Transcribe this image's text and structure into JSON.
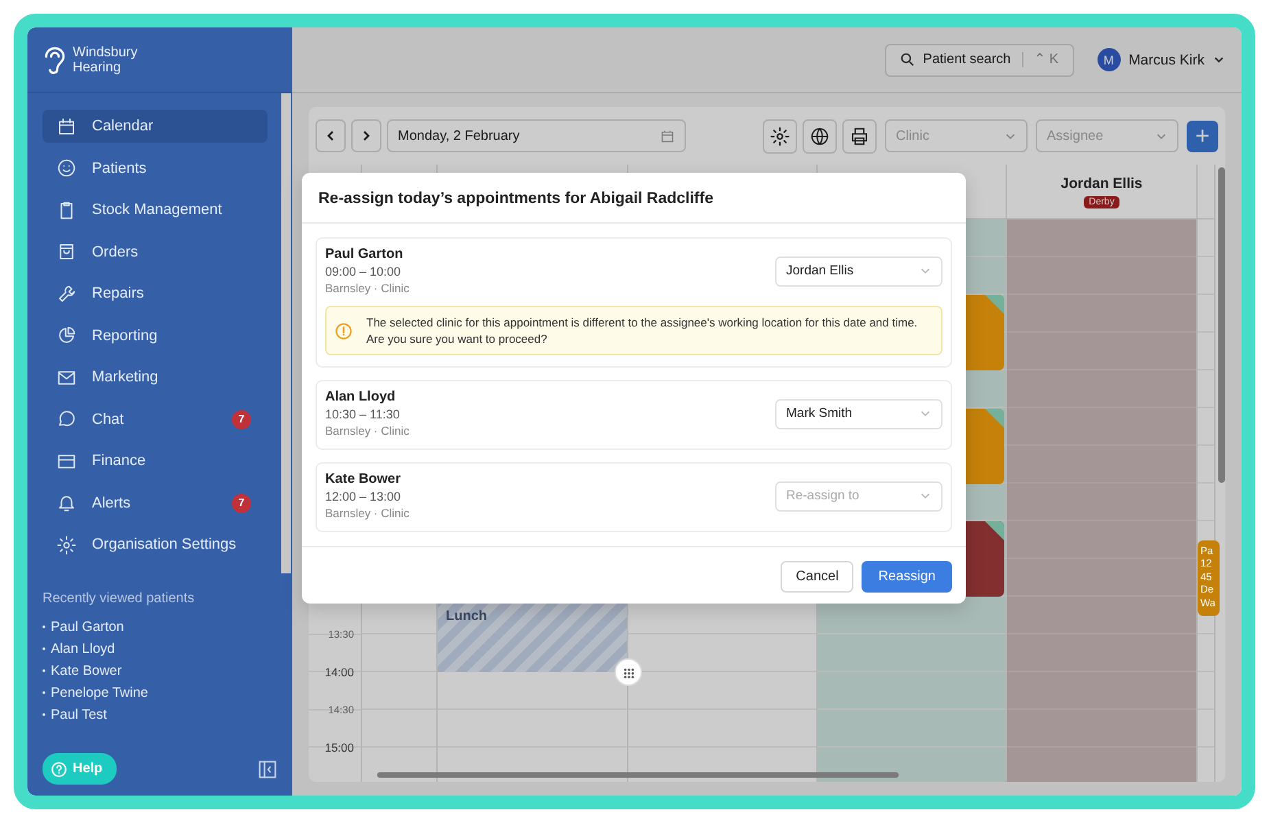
{
  "brand": {
    "line1": "Windsbury",
    "line2": "Hearing"
  },
  "nav": [
    {
      "label": "Calendar",
      "selected": true
    },
    {
      "label": "Patients",
      "selected": false
    },
    {
      "label": "Stock Management",
      "selected": false
    },
    {
      "label": "Orders",
      "selected": false
    },
    {
      "label": "Repairs",
      "selected": false
    },
    {
      "label": "Reporting",
      "selected": false
    },
    {
      "label": "Marketing",
      "selected": false
    },
    {
      "label": "Chat",
      "selected": false,
      "badge": "7"
    },
    {
      "label": "Finance",
      "selected": false
    },
    {
      "label": "Alerts",
      "selected": false,
      "badge": "7"
    },
    {
      "label": "Organisation Settings",
      "selected": false
    }
  ],
  "recent": {
    "title": "Recently viewed patients",
    "patients": [
      "Paul Garton",
      "Alan Lloyd",
      "Kate Bower",
      "Penelope Twine",
      "Paul Test"
    ]
  },
  "help": "Help",
  "topbar": {
    "search": "Patient search",
    "shortcut": "⌃ K",
    "user": {
      "initial": "M",
      "name": "Marcus Kirk"
    }
  },
  "toolbar": {
    "date": "Monday, 2 February",
    "clinic_placeholder": "Clinic",
    "assignee_placeholder": "Assignee",
    "add": "+"
  },
  "calendar": {
    "column_header": {
      "name": "Jordan Ellis",
      "location": "Derby"
    },
    "time_labels": [
      "13:30",
      "14:00",
      "14:30",
      "15:00"
    ],
    "events": [
      {
        "kind": "block",
        "color": "#c5810a"
      },
      {
        "kind": "block",
        "color": "#c5810a"
      },
      {
        "kind": "block",
        "color": "#832f30"
      },
      {
        "kind": "lunch",
        "label": "Lunch"
      },
      {
        "kind": "block",
        "color": "#c5810a",
        "lines": [
          "Pa",
          "12",
          "45",
          "De",
          "Wa"
        ]
      }
    ]
  },
  "dialog": {
    "title": "Re-assign today’s appointments for Abigail Radcliffe",
    "appointments": [
      {
        "patient": "Paul Garton",
        "time": "09:00 – 10:00",
        "location": "Barnsley · Clinic",
        "assignee": "Jordan Ellis",
        "warning": "The selected clinic for this appointment is different to the assignee's working location for this date and time. Are you sure you want to proceed?"
      },
      {
        "patient": "Alan Lloyd",
        "time": "10:30 – 11:30",
        "location": "Barnsley · Clinic",
        "assignee": "Mark Smith"
      },
      {
        "patient": "Kate Bower",
        "time": "12:00 – 13:00",
        "location": "Barnsley · Clinic",
        "placeholder": "Re-assign to"
      }
    ],
    "buttons": [
      {
        "label": "Cancel",
        "kind": "secondary"
      },
      {
        "label": "Reassign",
        "kind": "primary"
      }
    ]
  }
}
